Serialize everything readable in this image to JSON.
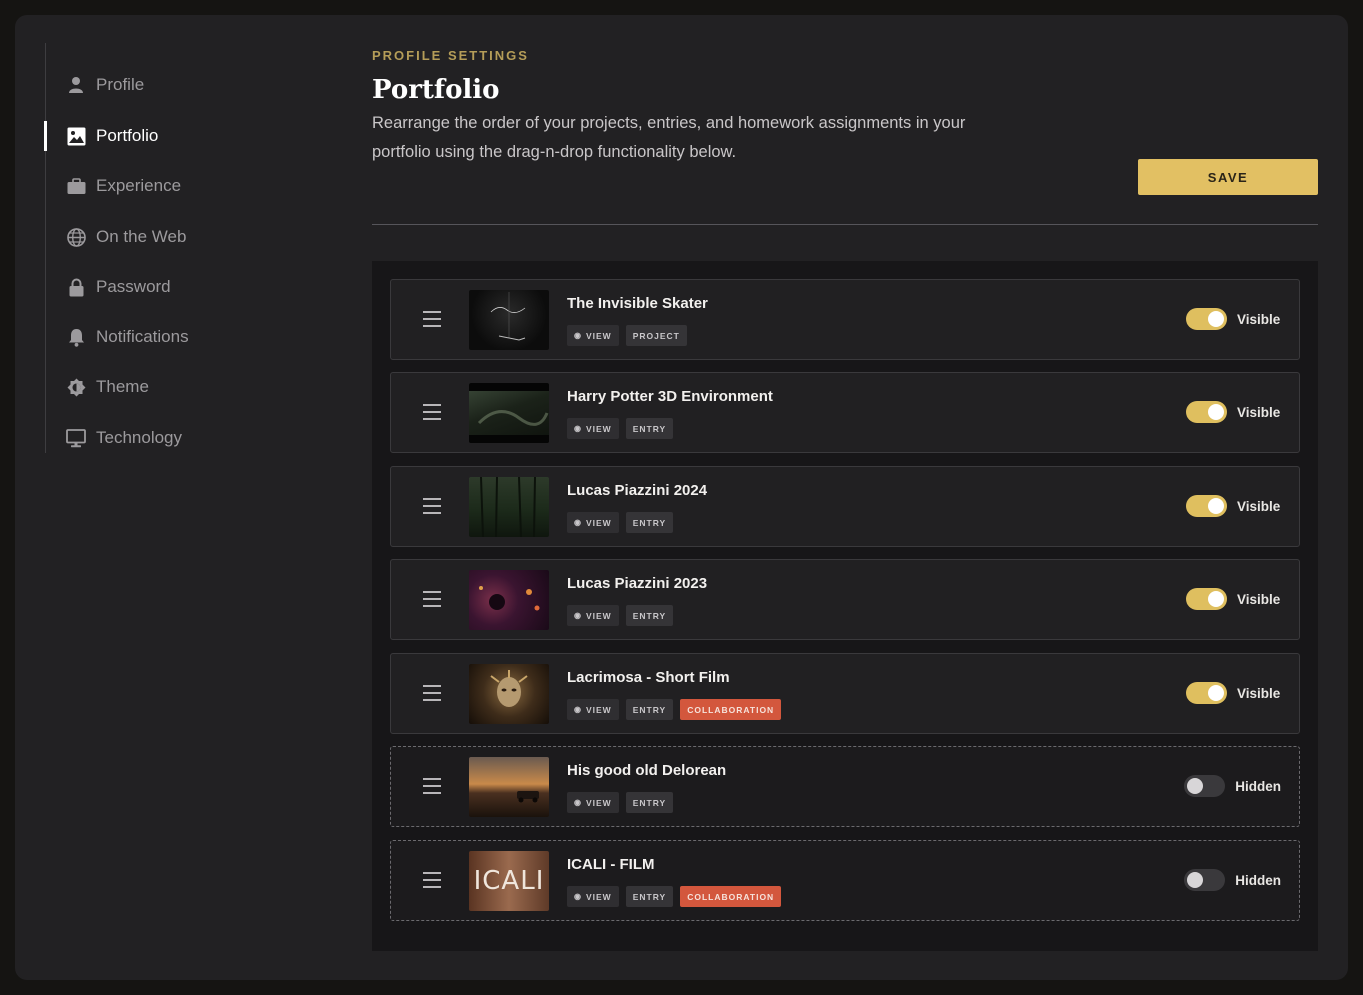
{
  "sidebar": {
    "items": [
      {
        "label": "Profile",
        "icon": "user-icon"
      },
      {
        "label": "Portfolio",
        "icon": "image-icon",
        "active": true
      },
      {
        "label": "Experience",
        "icon": "briefcase-icon"
      },
      {
        "label": "On the Web",
        "icon": "globe-icon"
      },
      {
        "label": "Password",
        "icon": "lock-icon"
      },
      {
        "label": "Notifications",
        "icon": "bell-icon"
      },
      {
        "label": "Theme",
        "icon": "theme-icon"
      },
      {
        "label": "Technology",
        "icon": "monitor-icon"
      }
    ]
  },
  "header": {
    "eyebrow": "PROFILE SETTINGS",
    "title": "Portfolio",
    "description": "Rearrange the order of your projects, entries, and homework assignments in your portfolio using the drag-n-drop functionality below.",
    "save_label": "SAVE"
  },
  "colors": {
    "accent": "#e2c063",
    "collaboration": "#d3573d",
    "background": "#222123"
  },
  "portfolio": {
    "view_label": "VIEW",
    "items": [
      {
        "title": "The Invisible Skater",
        "type": "PROJECT",
        "collaboration": "",
        "visibility": "Visible"
      },
      {
        "title": "Harry Potter 3D Environment",
        "type": "ENTRY",
        "collaboration": "",
        "visibility": "Visible"
      },
      {
        "title": "Lucas Piazzini 2024",
        "type": "ENTRY",
        "collaboration": "",
        "visibility": "Visible"
      },
      {
        "title": "Lucas Piazzini 2023",
        "type": "ENTRY",
        "collaboration": "",
        "visibility": "Visible"
      },
      {
        "title": "Lacrimosa - Short Film",
        "type": "ENTRY",
        "collaboration": "COLLABORATION",
        "visibility": "Visible"
      },
      {
        "title": "His good old Delorean",
        "type": "ENTRY",
        "collaboration": "",
        "visibility": "Hidden"
      },
      {
        "title": "ICALI - FILM",
        "type": "ENTRY",
        "collaboration": "COLLABORATION",
        "visibility": "Hidden",
        "thumb_text": "ICALI"
      }
    ]
  }
}
